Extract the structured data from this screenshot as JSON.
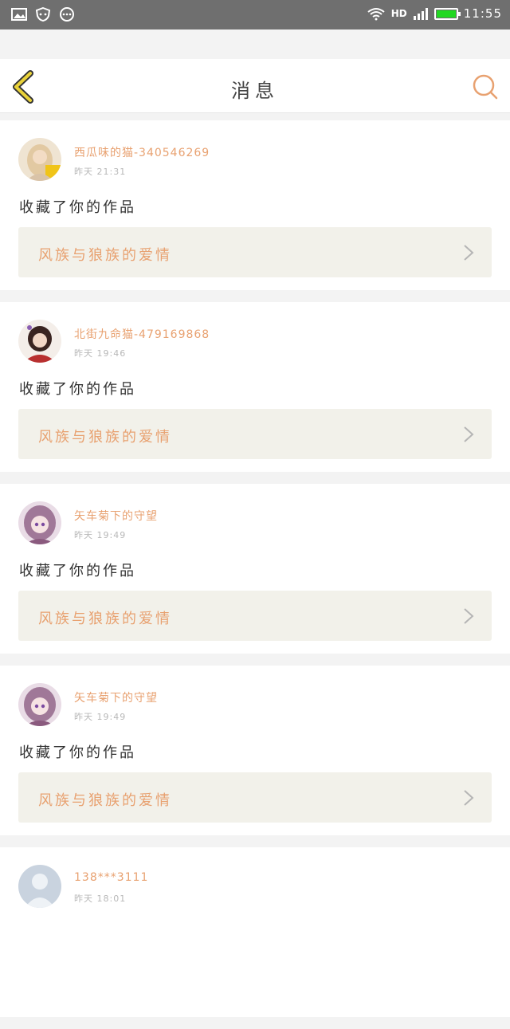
{
  "status_bar": {
    "time": "11:55",
    "network": "HD",
    "battery_color": "#22d822"
  },
  "header": {
    "title": "消息",
    "back_icon": "chevron-left-icon",
    "search_icon": "search-icon"
  },
  "messages": [
    {
      "user": "西瓜味的猫-340546269",
      "time": "昨天 21:31",
      "action": "收藏了你的作品",
      "work": "风族与狼族的爱情",
      "avatar_color": "#e8d2b5"
    },
    {
      "user": "北街九命猫-479169868",
      "time": "昨天 19:46",
      "action": "收藏了你的作品",
      "work": "风族与狼族的爱情",
      "avatar_color": "#b83030"
    },
    {
      "user": "矢车菊下的守望",
      "time": "昨天 19:49",
      "action": "收藏了你的作品",
      "work": "风族与狼族的爱情",
      "avatar_color": "#a07898"
    },
    {
      "user": "矢车菊下的守望",
      "time": "昨天 19:49",
      "action": "收藏了你的作品",
      "work": "风族与狼族的爱情",
      "avatar_color": "#a07898"
    },
    {
      "user": "138***3111",
      "time": "昨天 18:01",
      "action": "",
      "work": "",
      "avatar_color": "#c9d3df"
    }
  ],
  "colors": {
    "accent_orange": "#e8a170",
    "back_yellow": "#e9d23a",
    "link_bg": "#f2f1ea"
  }
}
